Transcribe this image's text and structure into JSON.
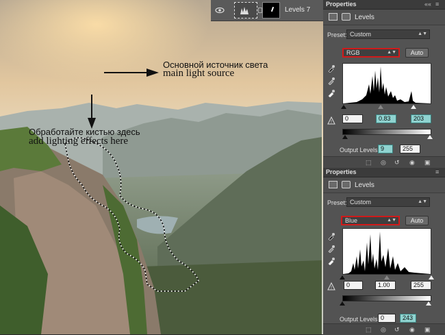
{
  "annotations": {
    "light_ru": "Основной источник света",
    "light_en": "main light source",
    "brush_ru": "Обработайте кистью здесь",
    "brush_en": "add lighting effects here"
  },
  "layer": {
    "name": "Levels 7"
  },
  "panels": [
    {
      "tab": "Properties",
      "title": "Levels",
      "preset_label": "Preset:",
      "preset_value": "Custom",
      "channel": "RGB",
      "auto_label": "Auto",
      "input_black": "0",
      "input_gamma": "0.83",
      "input_white": "203",
      "output_label": "Output Levels:",
      "output_black": "9",
      "output_white": "255"
    },
    {
      "tab": "Properties",
      "title": "Levels",
      "preset_label": "Preset:",
      "preset_value": "Custom",
      "channel": "Blue",
      "auto_label": "Auto",
      "input_black": "0",
      "input_gamma": "1.00",
      "input_white": "255",
      "output_label": "Output Levels:",
      "output_black": "0",
      "output_white": "243"
    }
  ],
  "icons": {
    "eye": "eye-icon",
    "adjustment": "levels-adjustment-icon",
    "mask": "layer-mask-icon",
    "eyedropper_black": "black-eyedropper-icon",
    "eyedropper_gray": "gray-eyedropper-icon",
    "eyedropper_white": "white-eyedropper-icon",
    "warning": "clipping-warning-icon",
    "clip": "clip-to-layer-icon",
    "view_prev": "view-previous-icon",
    "reset": "reset-icon",
    "visibility": "visibility-icon",
    "trash": "trash-icon"
  },
  "colors": {
    "panel_bg": "#535353",
    "highlight_field": "#8fd3d0",
    "channel_outline": "#d11a1a"
  }
}
